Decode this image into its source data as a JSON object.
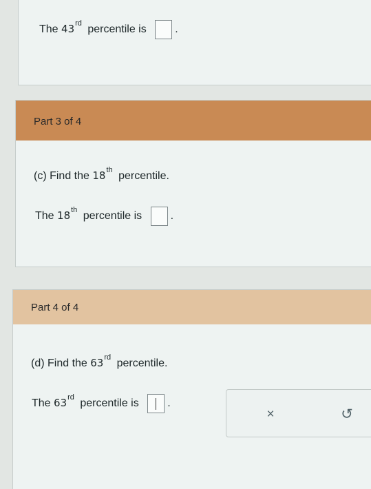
{
  "part2": {
    "answer": {
      "prefix": "The",
      "number": "43",
      "suffix": "rd",
      "text": "percentile is",
      "end": "."
    }
  },
  "part3": {
    "header": "Part 3 of 4",
    "question": {
      "prefix": "(c) Find the",
      "number": "18",
      "suffix": "th",
      "text": "percentile."
    },
    "answer": {
      "prefix": "The",
      "number": "18",
      "suffix": "th",
      "text": "percentile is",
      "end": "."
    }
  },
  "part4": {
    "header": "Part 4 of 4",
    "question": {
      "prefix": "(d) Find the",
      "number": "63",
      "suffix": "rd",
      "text": "percentile."
    },
    "answer": {
      "prefix": "The",
      "number": "63",
      "suffix": "rd",
      "text": "percentile is",
      "end": "."
    }
  },
  "actions": {
    "clear_icon": "×",
    "undo_icon": "↺"
  }
}
